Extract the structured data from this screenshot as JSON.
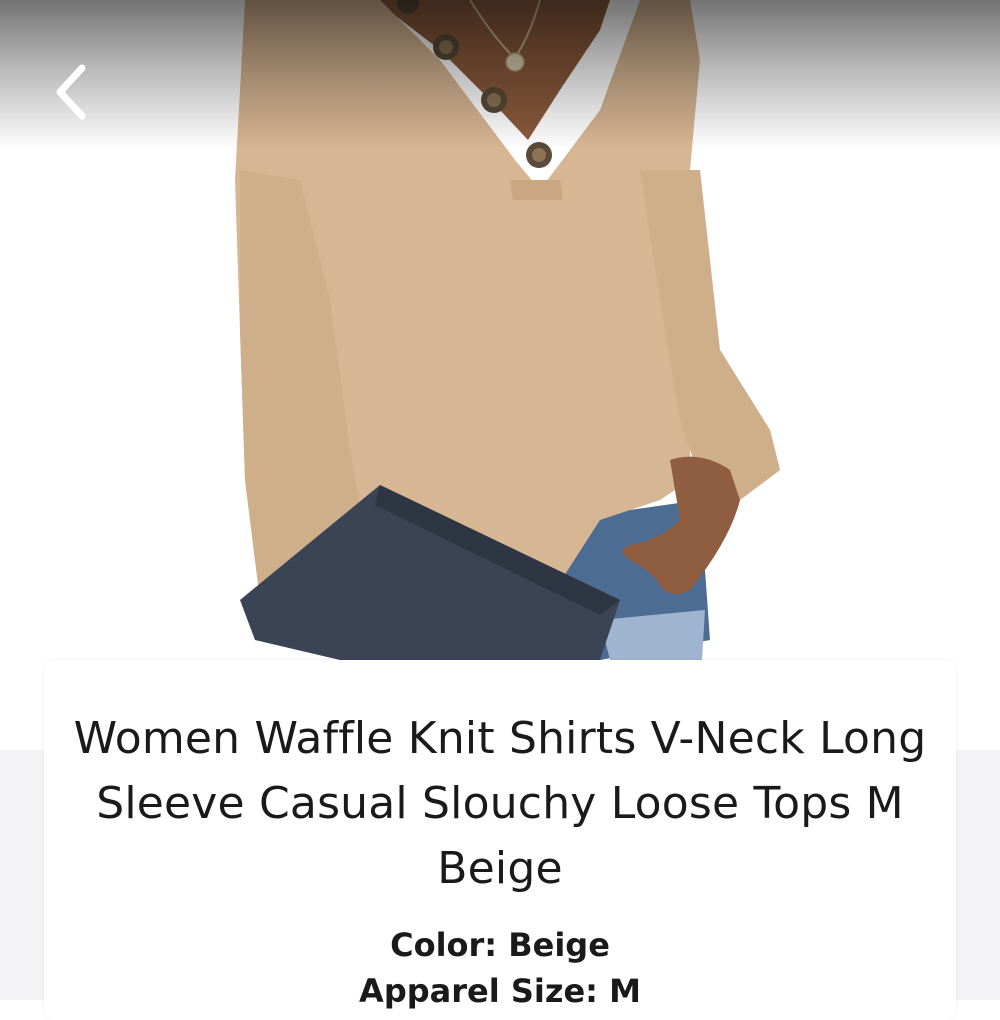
{
  "header": {
    "back_icon": "chevron-left-icon"
  },
  "product": {
    "image_icon": "product-photo",
    "title": "Women Waffle Knit Shirts V-Neck Long Sleeve Casual Slouchy Loose Tops M Beige",
    "color_label": "Color:",
    "color_value": "Beige",
    "size_label": "Apparel Size:",
    "size_value": "M"
  },
  "colors": {
    "sweater": "#d7b693",
    "clutch": "#3b4454",
    "denim": "#4d6c93",
    "background": "#ffffff",
    "section_bg": "#f3f3f5"
  }
}
